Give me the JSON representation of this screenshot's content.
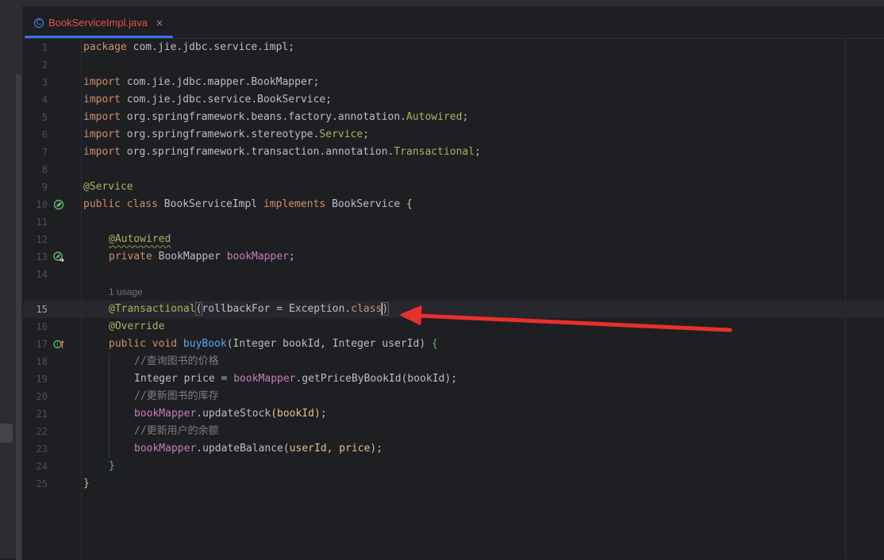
{
  "tab": {
    "filename": "BookServiceImpl.java",
    "icon": "java-class-icon",
    "close": "×"
  },
  "gutter": {
    "line_numbers": [
      "1",
      "2",
      "3",
      "4",
      "5",
      "6",
      "7",
      "8",
      "9",
      "10",
      "11",
      "12",
      "13",
      "14",
      "15",
      "16",
      "17",
      "18",
      "19",
      "20",
      "21",
      "22",
      "23",
      "24",
      "25"
    ],
    "active_line": "15"
  },
  "code": {
    "l1": {
      "kw": "package",
      "rest": " com.jie.jdbc.service.impl;"
    },
    "l3": {
      "kw": "import",
      "rest": " com.jie.jdbc.mapper.BookMapper;"
    },
    "l4": {
      "kw": "import",
      "rest": " com.jie.jdbc.service.BookService;"
    },
    "l5": {
      "kw": "import",
      "pkg": " org.springframework.beans.factory.annotation.",
      "cls": "Autowired",
      "end": ";"
    },
    "l6": {
      "kw": "import",
      "pkg": " org.springframework.stereotype.",
      "cls": "Service",
      "end": ";"
    },
    "l7": {
      "kw": "import",
      "pkg": " org.springframework.transaction.annotation.",
      "cls": "Transactional",
      "end": ";"
    },
    "l9": {
      "ann": "@Service"
    },
    "l10": {
      "kw1": "public class",
      "name": " BookServiceImpl ",
      "kw2": "implements",
      "iface": " BookService ",
      "brace": "{"
    },
    "l12": {
      "ann": "@Autowired"
    },
    "l13": {
      "kw": "private",
      "type": " BookMapper ",
      "field": "bookMapper",
      "end": ";"
    },
    "usage_hint": "1 usage",
    "l15": {
      "ann": "@Transactional",
      "open": "(",
      "arg": "rollbackFor = Exception.",
      "cls": "class",
      "close": ")"
    },
    "l16": {
      "ann": "@Override"
    },
    "l17": {
      "kw": "public void",
      "fn": " buyBook",
      "params": "(Integer bookId, Integer userId) ",
      "brace": "{"
    },
    "l18": {
      "comment": "//查询图书的价格"
    },
    "l19": {
      "type": "Integer price = ",
      "field": "bookMapper",
      "call": ".getPriceByBookId",
      "args": "(bookId)",
      "end": ";"
    },
    "l20": {
      "comment": "//更新图书的库存"
    },
    "l21": {
      "field": "bookMapper",
      "call": ".updateStock",
      "args": "(bookId)",
      "end": ";"
    },
    "l22": {
      "comment": "//更新用户的余额"
    },
    "l23": {
      "field": "bookMapper",
      "call": ".updateBalance",
      "args": "(userId, price)",
      "end": ";"
    },
    "l24": {
      "brace": "}"
    },
    "l25": {
      "brace": "}"
    }
  },
  "gutter_icons": [
    {
      "line": "10",
      "icon": "spring-bean-icon"
    },
    {
      "line": "13",
      "icon": "spring-autowired-navigate-icon"
    },
    {
      "line": "17",
      "icon": "implements-method-icon"
    }
  ],
  "annotation": {
    "arrow_color": "#e8302c",
    "points_to_line": "15"
  },
  "colors": {
    "background": "#1e1f22",
    "keyword": "#cf8e6d",
    "annotation": "#b3ae60",
    "field": "#c77dbb",
    "method": "#56a8f5",
    "comment": "#7a7e85",
    "tab_accent": "#3574f0",
    "tab_text": "#e0553d"
  }
}
